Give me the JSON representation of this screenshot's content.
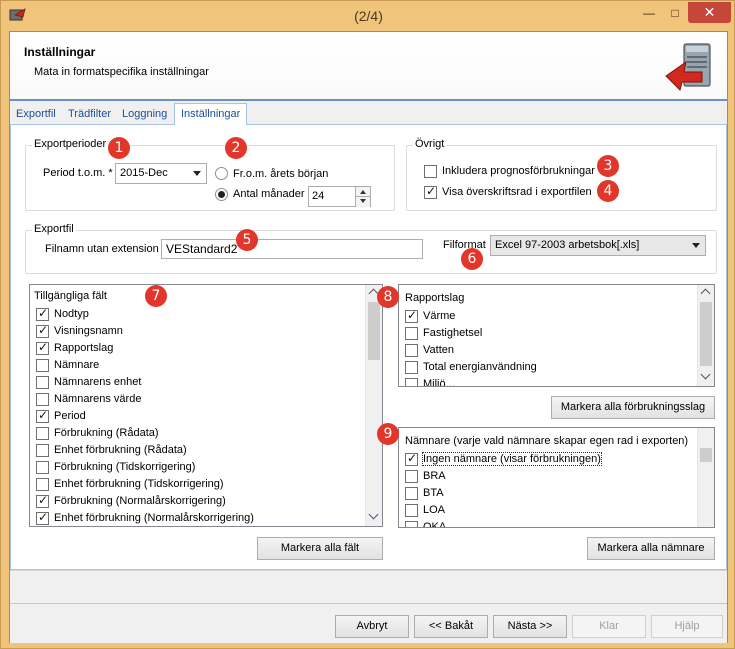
{
  "window": {
    "title": "(2/4)",
    "controls": {
      "minimize": "—",
      "maximize": "□",
      "close": "✕"
    }
  },
  "header": {
    "title": "Inställningar",
    "subtitle": "Mata in formatspecifika inställningar"
  },
  "tabs": [
    {
      "label": "Exportfil"
    },
    {
      "label": "Trädfilter"
    },
    {
      "label": "Loggning"
    },
    {
      "label": "Inställningar",
      "active": true
    }
  ],
  "export_periods": {
    "title": "Exportperioder",
    "period_label": "Period t.o.m. *",
    "period_value": "2015-Dec",
    "radio_from_year_start": "Fr.o.m. årets början",
    "radio_months": "Antal månader",
    "months_value": "24"
  },
  "other": {
    "title": "Övrigt",
    "include_forecast": "Inkludera prognosförbrukningar",
    "include_forecast_checked": false,
    "show_header_row": "Visa överskriftsrad i exportfilen",
    "show_header_row_checked": true
  },
  "export_file": {
    "title": "Exportfil",
    "filename_label": "Filnamn utan extension",
    "filename_value": "VEStandard2",
    "format_label": "Filformat",
    "format_value": "Excel 97-2003 arbetsbok[.xls]"
  },
  "available_fields": {
    "header": "Tillgängliga fält",
    "items": [
      {
        "label": "Nodtyp",
        "checked": true
      },
      {
        "label": "Visningsnamn",
        "checked": true
      },
      {
        "label": "Rapportslag",
        "checked": true
      },
      {
        "label": "Nämnare",
        "checked": false
      },
      {
        "label": "Nämnarens enhet",
        "checked": false
      },
      {
        "label": "Nämnarens värde",
        "checked": false
      },
      {
        "label": "Period",
        "checked": true
      },
      {
        "label": "Förbrukning (Rådata)",
        "checked": false
      },
      {
        "label": "Enhet förbrukning (Rådata)",
        "checked": false
      },
      {
        "label": "Förbrukning (Tidskorrigering)",
        "checked": false
      },
      {
        "label": "Enhet förbrukning (Tidskorrigering)",
        "checked": false
      },
      {
        "label": "Förbrukning (Normalårskorrigering)",
        "checked": true
      },
      {
        "label": "Enhet förbrukning (Normalårskorrigering)",
        "checked": true
      }
    ],
    "mark_all_button": "Markera alla fält"
  },
  "report_types": {
    "header": "Rapportslag",
    "items": [
      {
        "label": "Värme",
        "checked": true
      },
      {
        "label": "Fastighetsel",
        "checked": false
      },
      {
        "label": "Vatten",
        "checked": false
      },
      {
        "label": "Total energianvändning",
        "checked": false
      },
      {
        "label": "Miljö...",
        "checked": false
      }
    ],
    "mark_all_button": "Markera alla förbrukningsslag"
  },
  "denominators": {
    "header": "Nämnare (varje vald nämnare skapar egen rad i exporten)",
    "items": [
      {
        "label": "Ingen nämnare (visar förbrukningen)",
        "checked": true
      },
      {
        "label": "BRA",
        "checked": false
      },
      {
        "label": "BTA",
        "checked": false
      },
      {
        "label": "LOA",
        "checked": false
      },
      {
        "label": "OKA",
        "checked": false
      }
    ],
    "mark_all_button": "Markera alla nämnare"
  },
  "badges": [
    "1",
    "2",
    "3",
    "4",
    "5",
    "6",
    "7",
    "8",
    "9"
  ],
  "footer": {
    "cancel": "Avbryt",
    "back": "<< Bakåt",
    "next": "Nästa >>",
    "finish": "Klar",
    "help": "Hjälp"
  }
}
